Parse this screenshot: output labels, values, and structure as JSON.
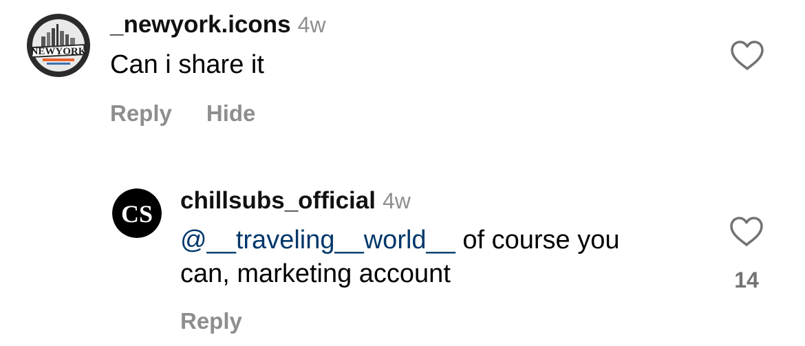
{
  "comments": [
    {
      "username": "_newyork.icons",
      "timestamp": "4w",
      "text": "Can i share it",
      "avatar": {
        "icon": "newyork-logo",
        "logo_text": "NEWYORK",
        "ring_color": "#2b2b2b",
        "accent": "#e8632b"
      },
      "actions": {
        "reply": "Reply",
        "hide": "Hide"
      },
      "like_count": ""
    }
  ],
  "replies": [
    {
      "username": "chillsubs_official",
      "timestamp": "4w",
      "mention": "@__traveling__world__",
      "text_line1": " of course you",
      "text_line2": "can, marketing account",
      "avatar": {
        "icon": "chillsubs-logo",
        "logo_text": "CS",
        "bg": "#000000"
      },
      "actions": {
        "reply": "Reply"
      },
      "like_count": "14"
    }
  ],
  "colors": {
    "mention": "#00376b",
    "secondary_text": "#8e8e8e",
    "heart_stroke": "#737373"
  }
}
